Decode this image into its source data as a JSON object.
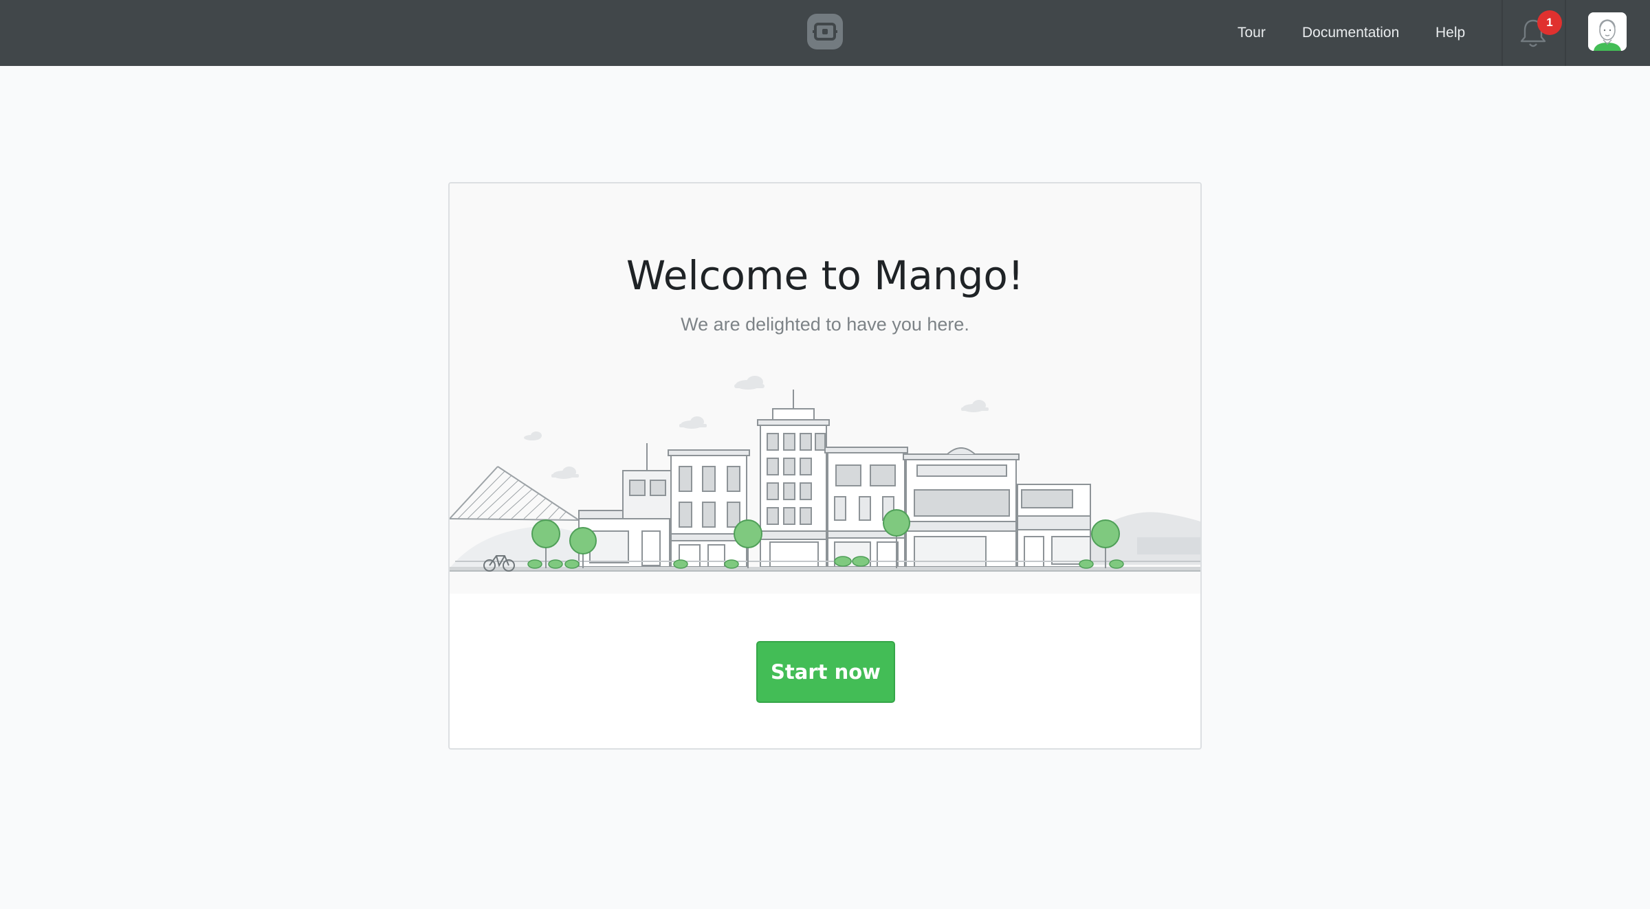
{
  "nav": {
    "tour": "Tour",
    "documentation": "Documentation",
    "help": "Help",
    "notification_count": "1"
  },
  "welcome": {
    "title": "Welcome to Mango!",
    "subtitle": "We are delighted to have you here.",
    "start_button": "Start now"
  },
  "icons": {
    "logo": "mango-logo-icon",
    "notifications": "bell-icon",
    "profile": "avatar",
    "illustration": "city-street-illustration"
  },
  "colors": {
    "topbar": "#41474a",
    "primary": "#43bd56",
    "badge": "#e0312f",
    "tree": "#7fc97f"
  }
}
